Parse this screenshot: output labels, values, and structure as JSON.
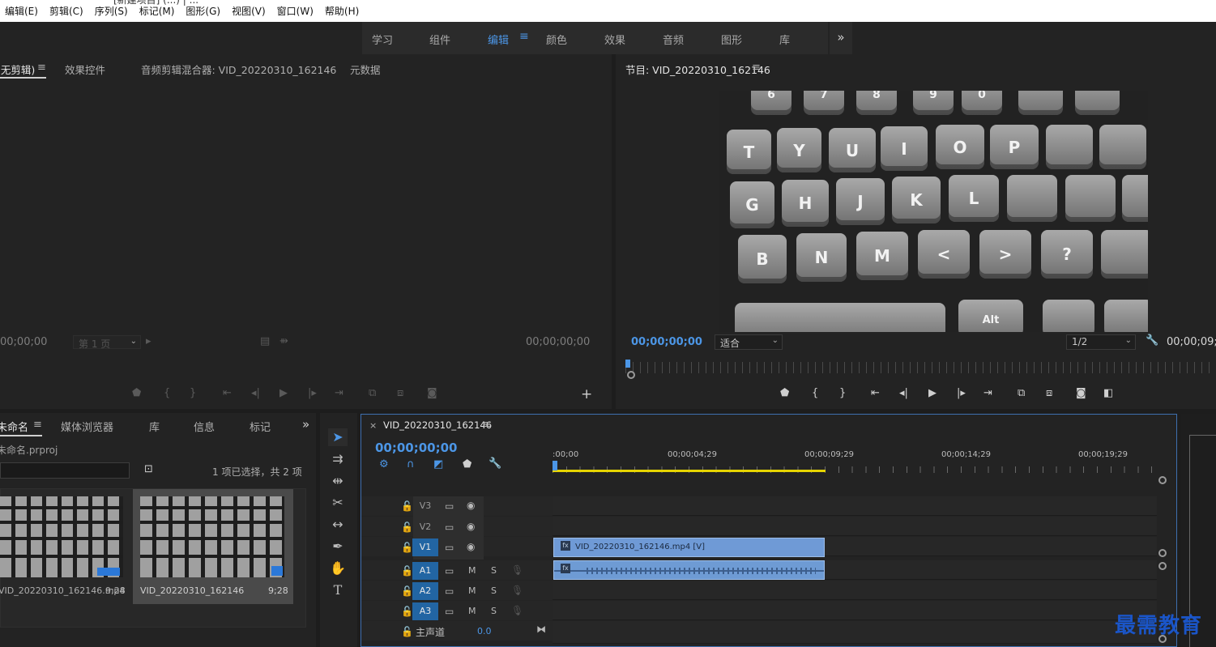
{
  "window_title_fragment": "[新建项目] (...) | ...",
  "menu": [
    "编辑(E)",
    "剪辑(C)",
    "序列(S)",
    "标记(M)",
    "图形(G)",
    "视图(V)",
    "窗口(W)",
    "帮助(H)"
  ],
  "workspaces": {
    "items": [
      "学习",
      "组件",
      "编辑",
      "颜色",
      "效果",
      "音频",
      "图形",
      "库"
    ],
    "active": "编辑",
    "more": "»"
  },
  "source_panel": {
    "tabs": [
      "(无剪辑)",
      "效果控件",
      "音频剪辑混合器: VID_20220310_162146",
      "元数据"
    ],
    "tab_active_menu": "≡",
    "timecode_left": "00;00;00",
    "page_select": "第 1 页",
    "timecode_right": "00;00;00;00",
    "add_button": "+"
  },
  "program_panel": {
    "title": "节目: VID_20220310_162146",
    "menu": "≡",
    "timecode_left": "00;00;00;00",
    "fit_select": "适合",
    "resolution_select": "1/2",
    "timecode_right": "00;00;09;",
    "keyboard_rows": [
      [
        "6",
        "7",
        "8",
        "9",
        "0"
      ],
      [
        "T",
        "Y",
        "U",
        "I",
        "O",
        "P"
      ],
      [
        "G",
        "H",
        "J",
        "K",
        "L"
      ],
      [
        "B",
        "N",
        "M",
        "<",
        ">",
        "?"
      ],
      [
        "Alt"
      ]
    ]
  },
  "project_panel": {
    "tabs": [
      "未命名",
      "媒体浏览器",
      "库",
      "信息",
      "标记"
    ],
    "active_tab": "未命名",
    "more": "»",
    "file": "未命名.prproj",
    "selection_info": "1 项已选择，共 2 项",
    "items": [
      {
        "name": "VID_20220310_162146.mp4",
        "duration": "9;28"
      },
      {
        "name": "VID_20220310_162146",
        "duration": "9;28"
      }
    ]
  },
  "timeline": {
    "tab_title": "VID_20220310_162146",
    "close": "×",
    "menu": "≡",
    "timecode": "00;00;00;00",
    "ruler_labels": [
      ":00;00",
      "00;00;04;29",
      "00;00;09;29",
      "00;00;14;29",
      "00;00;19;29"
    ],
    "video_tracks": [
      "V3",
      "V2",
      "V1"
    ],
    "audio_tracks": [
      "A1",
      "A2",
      "A3"
    ],
    "audio_toggles": {
      "mute": "M",
      "solo": "S"
    },
    "master": {
      "label": "主声道",
      "value": "0.0"
    },
    "clip_video_label": "VID_20220310_162146.mp4 [V]"
  },
  "watermark": "最需教育",
  "colors": {
    "accent": "#4c96e6",
    "clip": "#6f9ad6",
    "target_track": "#2265a3",
    "watermark": "#1a55c8"
  }
}
